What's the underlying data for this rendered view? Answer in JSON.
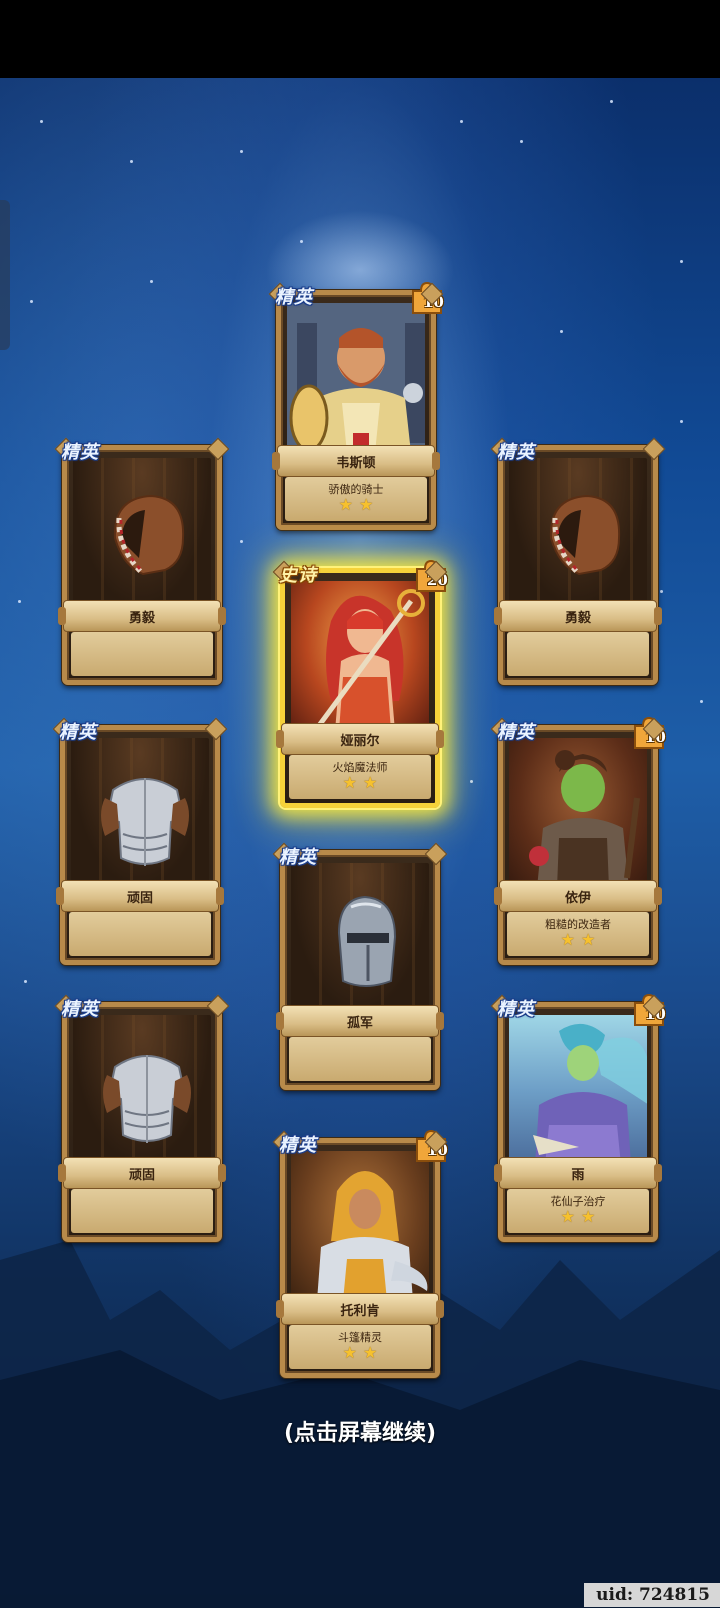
{
  "cards": [
    {
      "id": "c1",
      "rarity": "精英",
      "name": "韦斯顿",
      "subtitle": "骄傲的骑士",
      "stars": 2,
      "shards": "10",
      "type": "hero"
    },
    {
      "id": "c2",
      "rarity": "精英",
      "name": "勇毅",
      "type": "item"
    },
    {
      "id": "c3",
      "rarity": "精英",
      "name": "勇毅",
      "type": "item"
    },
    {
      "id": "c4",
      "rarity": "史诗",
      "name": "娅丽尔",
      "subtitle": "火焰魔法师",
      "stars": 2,
      "shards": "20",
      "type": "hero"
    },
    {
      "id": "c5",
      "rarity": "精英",
      "name": "顽固",
      "type": "item"
    },
    {
      "id": "c6",
      "rarity": "精英",
      "name": "依伊",
      "subtitle": "粗糙的改造者",
      "stars": 2,
      "shards": "10",
      "type": "hero"
    },
    {
      "id": "c7",
      "rarity": "精英",
      "name": "孤军",
      "type": "item"
    },
    {
      "id": "c8",
      "rarity": "精英",
      "name": "顽固",
      "type": "item"
    },
    {
      "id": "c9",
      "rarity": "精英",
      "name": "雨",
      "subtitle": "花仙子治疗",
      "stars": 2,
      "shards": "10",
      "type": "hero"
    },
    {
      "id": "c10",
      "rarity": "精英",
      "name": "托利肯",
      "subtitle": "斗篷精灵",
      "stars": 2,
      "shards": "10",
      "type": "hero"
    }
  ],
  "continue_text": "(点击屏幕继续)",
  "uid_text": "uid: 724815",
  "colors": {
    "star": "#f6c12e",
    "epic_glow": "#f6d23a",
    "frame": "#b88a4a"
  }
}
